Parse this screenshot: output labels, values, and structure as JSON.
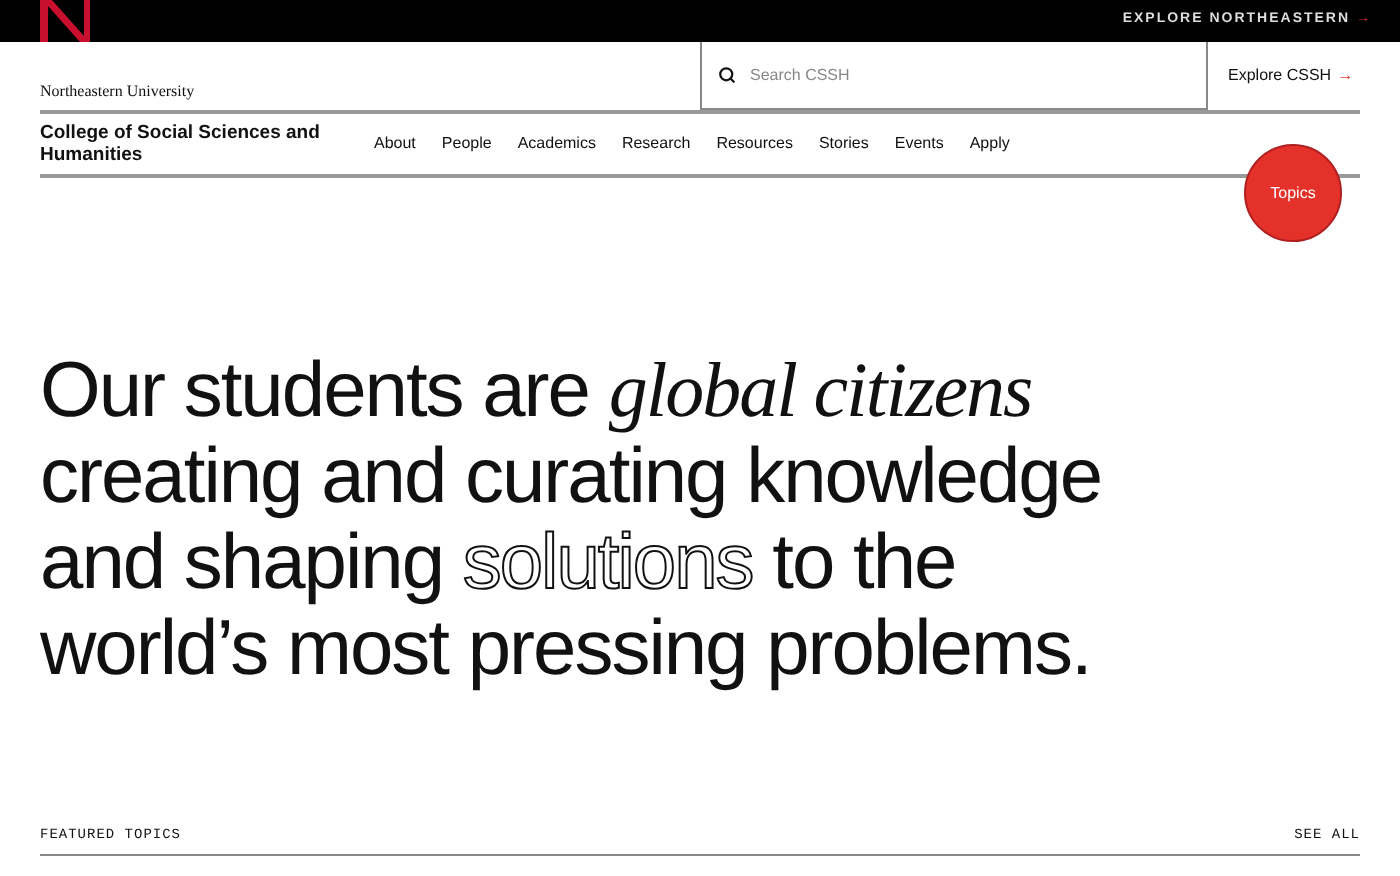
{
  "top_bar": {
    "link": "EXPLORE NORTHEASTERN",
    "arrow": "→"
  },
  "header": {
    "university": "Northeastern University",
    "college": "College of Social Sciences and Humanities",
    "search": {
      "placeholder": "Search CSSH"
    },
    "explore": {
      "label": "Explore CSSH",
      "arrow": "→"
    }
  },
  "nav": {
    "items": [
      "About",
      "People",
      "Academics",
      "Research",
      "Resources",
      "Stories",
      "Events",
      "Apply"
    ]
  },
  "topics_button": "Topics",
  "headline": [
    {
      "kind": "plain",
      "text": "Our students are "
    },
    {
      "kind": "italic",
      "text": "global citizens"
    },
    {
      "kind": "plain",
      "text": " creating and curating knowledge and shaping "
    },
    {
      "kind": "outline",
      "text": "solutions"
    },
    {
      "kind": "plain",
      "text": " to the world’s most pressing problems."
    }
  ],
  "featured": {
    "title": "FEATURED TOPICS",
    "link": "SEE ALL"
  }
}
